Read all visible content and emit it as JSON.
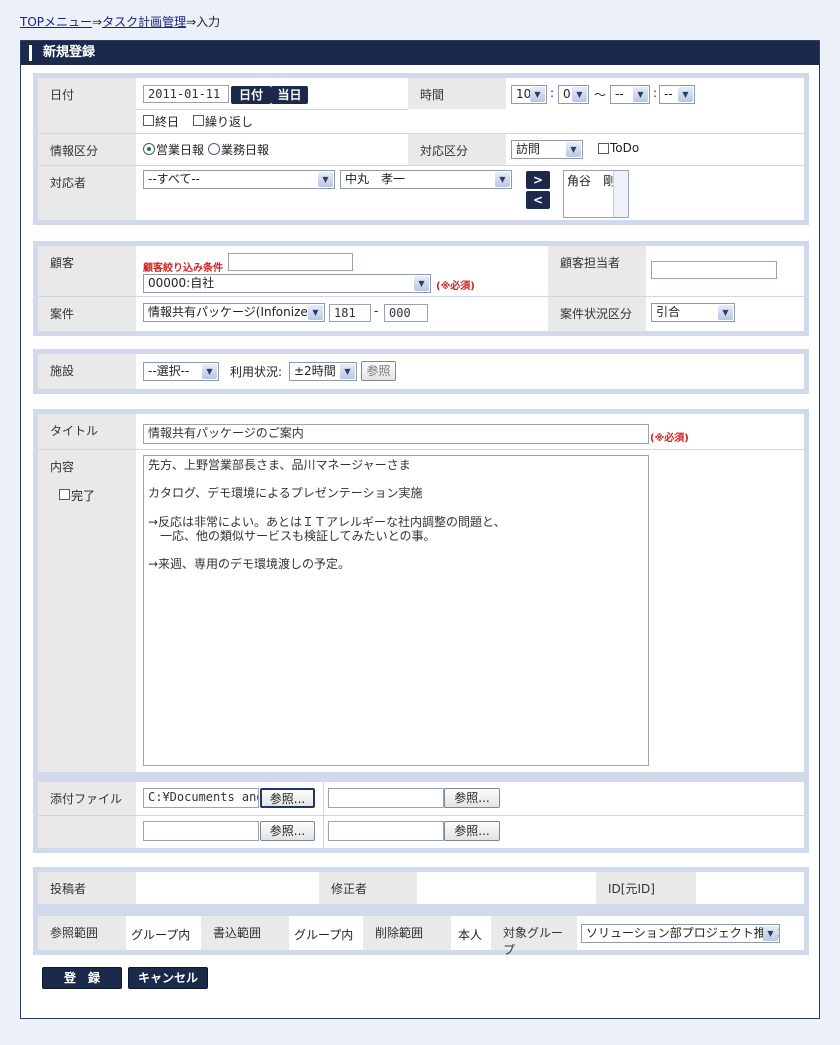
{
  "breadcrumb": {
    "top_menu": "TOPメニュー",
    "sep1": "⇒",
    "task_mgmt": "タスク計画管理",
    "sep2": "⇒",
    "current": "入力"
  },
  "header": {
    "title": "新規登録"
  },
  "schedule": {
    "date_label": "日付",
    "date_value": "2011-01-11",
    "date_btn": "日付",
    "today_btn": "当日",
    "allday_label": "終日",
    "repeat_label": "繰り返し",
    "time_label": "時間",
    "time_start_hour": "10",
    "time_start_min": "0",
    "time_sep": "～",
    "time_end_hour": "--",
    "time_end_min": "--",
    "colon": ":",
    "info_type_label": "情報区分",
    "info_type_opt1": "営業日報",
    "info_type_opt2": "業務日報",
    "response_type_label": "対応区分",
    "response_type_value": "訪問",
    "todo_label": "ToDo",
    "responder_label": "対応者",
    "responder_group": "--すべて--",
    "responder_person": "中丸　孝一",
    "add_btn": ">",
    "remove_btn": "<",
    "selected_responder": "角谷　剛"
  },
  "customer": {
    "label": "顧客",
    "filter_label": "顧客絞り込み条件",
    "filter_value": "",
    "customer_value": "00000:自社",
    "required_mark": "(※必須)",
    "contact_label": "顧客担当者",
    "contact_value": "",
    "project_label": "案件",
    "project_value": "情報共有パッケージ(Infonizer)",
    "project_code1": "181",
    "dash": "-",
    "project_code2": "000",
    "project_status_label": "案件状況区分",
    "project_status_value": "引合"
  },
  "facility": {
    "label": "施設",
    "value": "--選択--",
    "usage_label": "利用状況:",
    "usage_value": "±2時間",
    "ref_btn": "参照"
  },
  "content": {
    "title_label": "タイトル",
    "title_value": "情報共有パッケージのご案内",
    "required_mark": "(※必須)",
    "body_label": "内容",
    "done_label": "完了",
    "body_lines": [
      "先方、上野営業部長さま、品川マネージャーさま",
      "",
      "カタログ、デモ環境によるプレゼンテーション実施",
      "",
      "→反応は非常によい。あとはＩＴアレルギーな社内調整の問題と、",
      "　一応、他の類似サービスも検証してみたいとの事。",
      "",
      "→来週、専用のデモ環境渡しの予定。"
    ],
    "attach_label": "添付ファイル",
    "attach1_value": "C:¥Documents and",
    "attach2_value": "",
    "attach3_value": "",
    "attach4_value": "",
    "browse_btn": "参照..."
  },
  "meta": {
    "poster_label": "投稿者",
    "poster_value": "",
    "editor_label": "修正者",
    "editor_value": "",
    "id_label": "ID[元ID]",
    "id_value": "",
    "view_scope_label": "参照範囲",
    "view_scope_value": "グループ内",
    "write_scope_label": "書込範囲",
    "write_scope_value": "グループ内",
    "delete_scope_label": "削除範囲",
    "delete_scope_value": "本人",
    "target_group_label": "対象グループ",
    "target_group_value": "ソリューション部プロジェクト推進課"
  },
  "actions": {
    "register_btn": "登　録",
    "cancel_btn": "キャンセル"
  }
}
